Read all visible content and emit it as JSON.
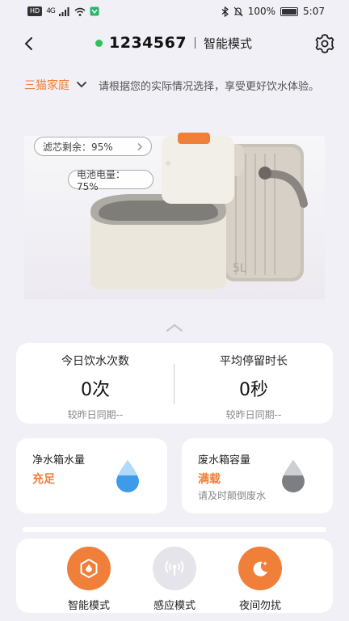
{
  "status_bar": {
    "hd": "HD",
    "network": "4G",
    "battery_text": "100%",
    "time": "5:07"
  },
  "header": {
    "device_id": "1234567",
    "mode_title": "智能模式",
    "online_color": "#2ec25a"
  },
  "notice": {
    "family_name": "三猫家庭",
    "text": "请根据您的实际情况选择，享受更好饮水体验。"
  },
  "product": {
    "filter_label": "滤芯剩余：95%",
    "battery_label": "电池电量：75%",
    "tank_volume": "5L"
  },
  "stats": {
    "left": {
      "label": "今日饮水次数",
      "value": "0次",
      "compare": "较昨日同期--"
    },
    "right": {
      "label": "平均停留时长",
      "value": "0秒",
      "compare": "较昨日同期--"
    }
  },
  "tanks": {
    "clean": {
      "title": "净水箱水量",
      "status": "充足",
      "drop_color": "#3d9be9"
    },
    "waste": {
      "title": "废水箱容量",
      "status": "满载",
      "tip": "请及时颠倒废水",
      "drop_color": "#7d7d84"
    }
  },
  "modes": [
    {
      "label": "智能模式",
      "icon": "hexagon-mode-icon",
      "active": true
    },
    {
      "label": "感应模式",
      "icon": "sensor-wave-icon",
      "active": false
    },
    {
      "label": "夜间勿扰",
      "icon": "moon-icon",
      "active": true
    }
  ],
  "colors": {
    "accent": "#f07f3a",
    "background": "#f0f0f6"
  }
}
